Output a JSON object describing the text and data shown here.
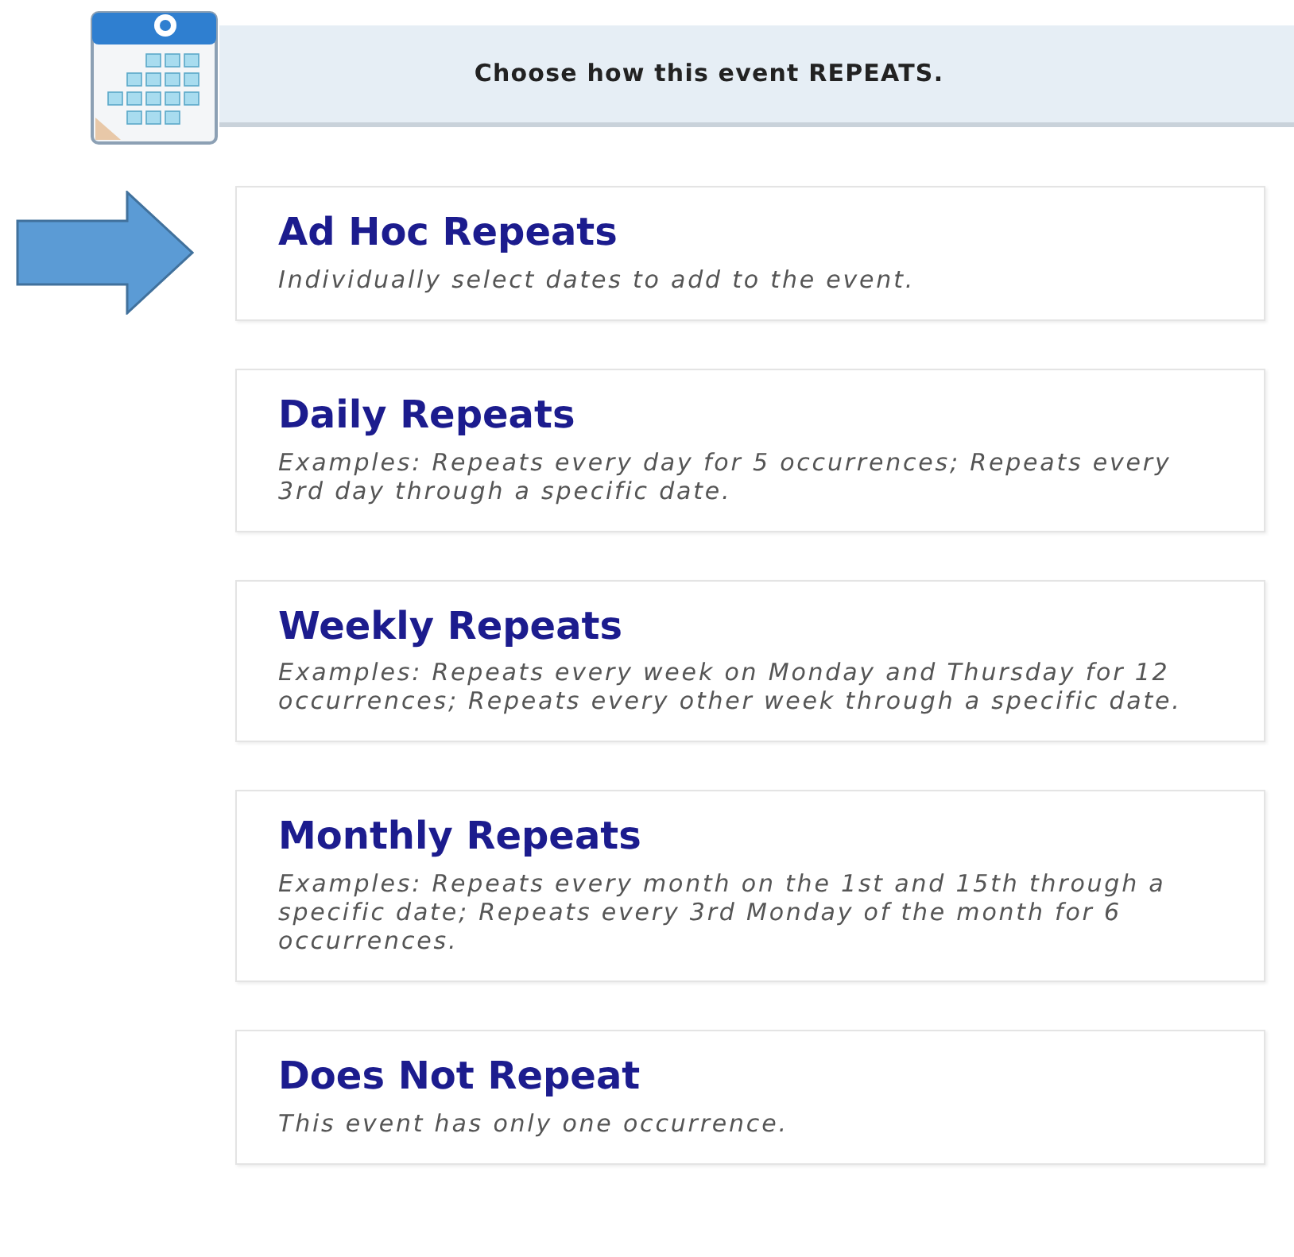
{
  "header": {
    "title": "Choose how this event REPEATS."
  },
  "options": [
    {
      "title": "Ad Hoc Repeats",
      "description": "Individually select dates to add to the event.",
      "pointed_at": true
    },
    {
      "title": "Daily Repeats",
      "description": "Examples: Repeats every day for 5 occurrences; Repeats every 3rd day through a specific date.",
      "pointed_at": false
    },
    {
      "title": "Weekly Repeats",
      "description": "Examples: Repeats every week on Monday and Thursday for 12 occurrences; Repeats every other week through a specific date.",
      "pointed_at": false
    },
    {
      "title": "Monthly Repeats",
      "description": "Examples: Repeats every month on the 1st and 15th through a specific date; Repeats every 3rd Monday of the month for 6 occurrences.",
      "pointed_at": false
    },
    {
      "title": "Does Not Repeat",
      "description": "This event has only one occurrence.",
      "pointed_at": false
    }
  ]
}
